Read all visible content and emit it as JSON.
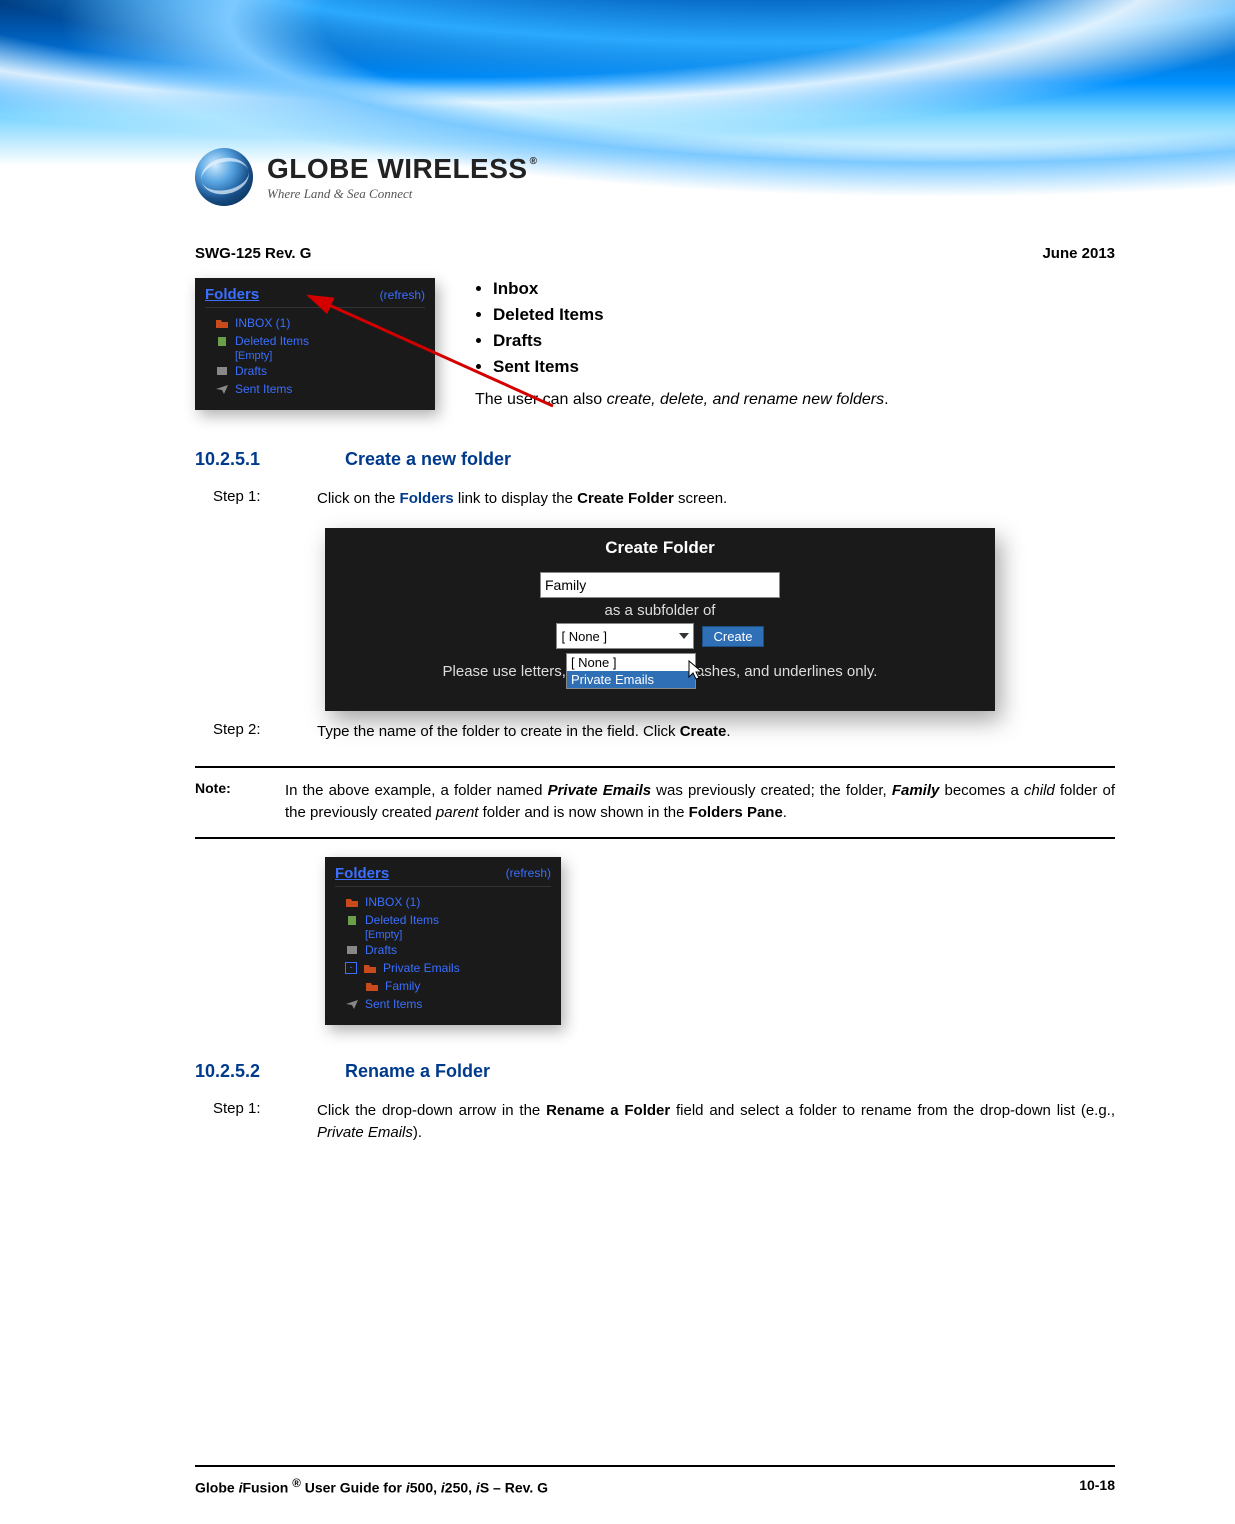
{
  "logo": {
    "title": "GLOBE WIRELESS",
    "reg": "®",
    "tagline": "Where Land & Sea Connect"
  },
  "docbar": {
    "left": "SWG-125 Rev. G",
    "right": "June 2013"
  },
  "folders_panel_1": {
    "title": "Folders",
    "refresh": "(refresh)",
    "items": [
      {
        "label": "INBOX (1)"
      },
      {
        "label": "Deleted Items"
      },
      {
        "empty": "[Empty]"
      },
      {
        "label": "Drafts"
      },
      {
        "label": "Sent Items"
      }
    ]
  },
  "bullets": [
    "Inbox",
    "Deleted Items",
    "Drafts",
    "Sent Items"
  ],
  "user_note": {
    "pre": "The user can also ",
    "em": "create, delete, and rename new folders",
    "post": "."
  },
  "section_1": {
    "num": "10.2.5.1",
    "title": "Create a new folder"
  },
  "step1a": {
    "label": "Step  1:",
    "pre": "Click on the ",
    "link": "Folders",
    "mid": " link to display the ",
    "bold": "Create Folder",
    "post": " screen."
  },
  "dialog": {
    "title": "Create Folder",
    "input_value": "Family",
    "sub_of": "as a subfolder of",
    "selected": "[ None ]",
    "create": "Create",
    "dd_opt1": "[ None ]",
    "dd_opt2": "Private Emails",
    "hint_pre": "Please use letters, ",
    "hint_post": "ashes, and underlines only."
  },
  "step2a": {
    "label": "Step  2:",
    "pre": "Type the name of the folder to create in the field. Click ",
    "bold": "Create",
    "post": "."
  },
  "note": {
    "label": "Note:",
    "t1": "In the above example, a folder named ",
    "bi1": "Private Emails",
    "t2": " was previously created; the folder, ",
    "bi2": "Family",
    "t3": " becomes a ",
    "it1": "child",
    "t4": " folder of the previously created ",
    "it2": "parent",
    "t5": " folder and is now shown in the ",
    "b1": "Folders Pane",
    "t6": "."
  },
  "folders_panel_2": {
    "title": "Folders",
    "refresh": "(refresh)",
    "items": [
      {
        "label": "INBOX (1)"
      },
      {
        "label": "Deleted Items"
      },
      {
        "empty": "[Empty]"
      },
      {
        "label": "Drafts"
      },
      {
        "label": "Private Emails",
        "expandable": true
      },
      {
        "label": "Family",
        "sub": true
      },
      {
        "label": "Sent Items"
      }
    ]
  },
  "section_2": {
    "num": "10.2.5.2",
    "title": "Rename a Folder"
  },
  "step1b": {
    "label": "Step  1:",
    "t1": "Click the drop-down arrow in the ",
    "b1": "Rename a Folder",
    "t2": " field and select a folder to rename from the drop-down list (e.g., ",
    "it1": "Private Emails",
    "t3": ")."
  },
  "footer": {
    "left_pre": "Globe ",
    "left_i1": "i",
    "left_mid1": "Fusion ",
    "left_reg": "®",
    "left_mid2": " User Guide for ",
    "left_i2": "i",
    "left_mid3": "500, ",
    "left_i3": "i",
    "left_mid4": "250, ",
    "left_i4": "i",
    "left_end": "S – Rev. G",
    "right": "10-18"
  }
}
